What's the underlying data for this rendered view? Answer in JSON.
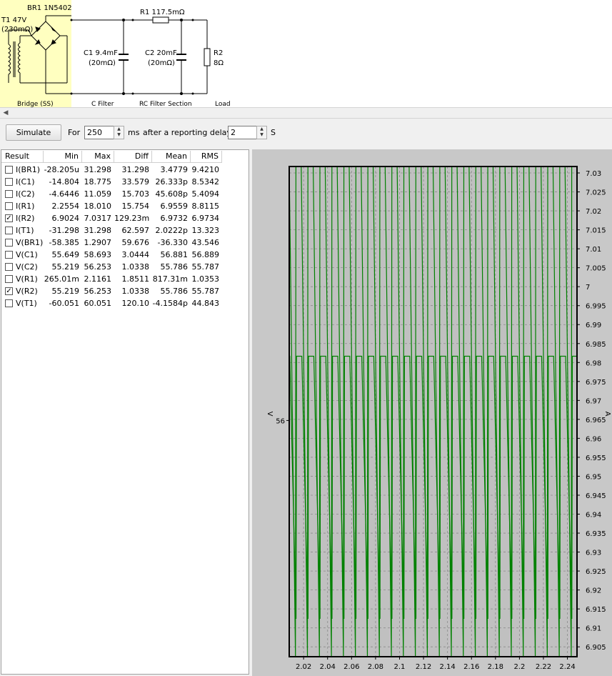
{
  "schematic": {
    "bridge_name": "BR1 1N5402",
    "transformer_name": "T1 47V",
    "transformer_res": "(230mΩ)",
    "r1_name": "R1 117.5mΩ",
    "c1_name": "C1 9.4mF",
    "c1_res": "(20mΩ)",
    "c2_name": "C2 20mF",
    "c2_res": "(20mΩ)",
    "r2_name": "R2",
    "r2_value": "8Ω",
    "section_bridge": "Bridge (SS)",
    "section_cfilter": "C Filter",
    "section_rc": "RC Filter Section",
    "section_load": "Load",
    "highlight_color": "#ffffc0"
  },
  "toolbar": {
    "simulate_label": "Simulate",
    "for_label": "For",
    "duration_value": "250",
    "ms_label": "ms",
    "delay_label": "after a reporting delay of",
    "delay_value": "2",
    "s_label": "S"
  },
  "table": {
    "headers": [
      "Result",
      "Min",
      "Max",
      "Diff",
      "Mean",
      "RMS"
    ],
    "rows": [
      {
        "name": "I(BR1)",
        "checked": false,
        "min": "-28.205u",
        "max": "31.298",
        "diff": "31.298",
        "mean": "3.4779",
        "rms": "9.4210"
      },
      {
        "name": "I(C1)",
        "checked": false,
        "min": "-14.804",
        "max": "18.775",
        "diff": "33.579",
        "mean": "26.333p",
        "rms": "8.5342"
      },
      {
        "name": "I(C2)",
        "checked": false,
        "min": "-4.6446",
        "max": "11.059",
        "diff": "15.703",
        "mean": "45.608p",
        "rms": "5.4094"
      },
      {
        "name": "I(R1)",
        "checked": false,
        "min": "2.2554",
        "max": "18.010",
        "diff": "15.754",
        "mean": "6.9559",
        "rms": "8.8115"
      },
      {
        "name": "I(R2)",
        "checked": true,
        "min": "6.9024",
        "max": "7.0317",
        "diff": "129.23m",
        "mean": "6.9732",
        "rms": "6.9734"
      },
      {
        "name": "I(T1)",
        "checked": false,
        "min": "-31.298",
        "max": "31.298",
        "diff": "62.597",
        "mean": "2.0222p",
        "rms": "13.323"
      },
      {
        "name": "V(BR1)",
        "checked": false,
        "min": "-58.385",
        "max": "1.2907",
        "diff": "59.676",
        "mean": "-36.330",
        "rms": "43.546"
      },
      {
        "name": "V(C1)",
        "checked": false,
        "min": "55.649",
        "max": "58.693",
        "diff": "3.0444",
        "mean": "56.881",
        "rms": "56.889"
      },
      {
        "name": "V(C2)",
        "checked": false,
        "min": "55.219",
        "max": "56.253",
        "diff": "1.0338",
        "mean": "55.786",
        "rms": "55.787"
      },
      {
        "name": "V(R1)",
        "checked": false,
        "min": "265.01m",
        "max": "2.1161",
        "diff": "1.8511",
        "mean": "817.31m",
        "rms": "1.0353"
      },
      {
        "name": "V(R2)",
        "checked": true,
        "min": "55.219",
        "max": "56.253",
        "diff": "1.0338",
        "mean": "55.786",
        "rms": "55.787"
      },
      {
        "name": "V(T1)",
        "checked": false,
        "min": "-60.051",
        "max": "60.051",
        "diff": "120.10",
        "mean": "-4.1584p",
        "rms": "44.843"
      }
    ]
  },
  "chart_data": {
    "type": "line",
    "title": "",
    "xlabel": "",
    "ylabel_left": "V",
    "ylabel_right": "A",
    "xlim": [
      2.008,
      2.248
    ],
    "x_ticks": [
      "2.02",
      "2.04",
      "2.06",
      "2.08",
      "2.1",
      "2.12",
      "2.14",
      "2.16",
      "2.18",
      "2.2",
      "2.22",
      "2.24"
    ],
    "y_left_ticks": [
      "56"
    ],
    "y_left_tick_values": [
      56
    ],
    "y_left_lim": [
      55.07,
      57.0
    ],
    "y_right_ticks": [
      "7.03",
      "7.025",
      "7.02",
      "7.015",
      "7.01",
      "7.005",
      "7",
      "6.995",
      "6.99",
      "6.985",
      "6.98",
      "6.975",
      "6.97",
      "6.965",
      "6.96",
      "6.955",
      "6.95",
      "6.945",
      "6.94",
      "6.935",
      "6.93",
      "6.925",
      "6.92",
      "6.915",
      "6.91",
      "6.905"
    ],
    "y_right_lim": [
      6.9024,
      7.0317
    ],
    "grid": true,
    "series": [
      {
        "name": "I(R2)",
        "axis": "right",
        "min": 6.9024,
        "max": 7.0317,
        "period": 0.01
      },
      {
        "name": "V(R2)",
        "axis": "left",
        "min": 55.219,
        "max": 56.253,
        "period": 0.01
      }
    ],
    "colors": {
      "series": "#008000",
      "plot_bg": "#c0c0c0",
      "panel_bg": "#c8c8c8"
    }
  }
}
